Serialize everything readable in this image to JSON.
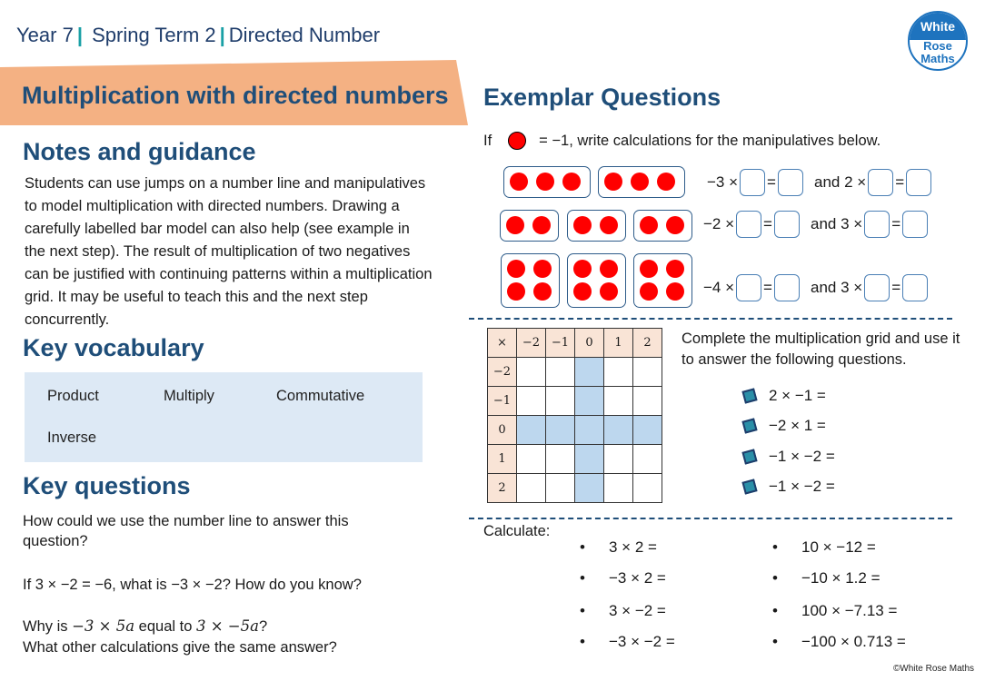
{
  "header": {
    "year": "Year 7",
    "term": "Spring Term  2",
    "unit": "Directed Number",
    "separator": "|",
    "logo": {
      "line1": "White",
      "line2": "Rose",
      "line3": "Maths"
    }
  },
  "left": {
    "title": "Multiplication with directed numbers",
    "notes_heading": "Notes and guidance",
    "notes_text": "Students can use jumps on a number line and manipulatives to model multiplication with directed numbers.  Drawing a carefully labelled bar model can also help (see example in the next step). The result of multiplication of two negatives can be justified with continuing patterns within a multiplication grid.  It may be useful to teach this and the next step concurrently.",
    "vocab_heading": "Key vocabulary",
    "vocab": [
      "Product",
      "Multiply",
      "Commutative",
      "Inverse"
    ],
    "questions_heading": "Key questions",
    "questions": {
      "q1": "How could we use the number line to answer this question?",
      "q2": "If 3 × −2 =  −6, what is −3 × −2?  How do you know?",
      "q3a_pre": "Why is ",
      "q3a_m1": "−3 × 5a",
      "q3a_mid": " equal to ",
      "q3a_m2": "3 × −5a",
      "q3a_post": "?",
      "q3b": "What other calculations give the same answer?"
    }
  },
  "right": {
    "heading": "Exemplar Questions",
    "intro_if": "If",
    "intro_rest": "=  −1, write calculations for the manipulatives below.",
    "rows": [
      {
        "groups": 2,
        "per_group": 3,
        "eq1_prefix": "−3 ×",
        "eq2_prefix": "and 2 ×"
      },
      {
        "groups": 3,
        "per_group": 2,
        "eq1_prefix": "−2 ×",
        "eq2_prefix": "and 3 ×"
      },
      {
        "groups": 3,
        "per_group": 4,
        "eq1_prefix": "−4 ×",
        "eq2_prefix": "and 3 ×"
      }
    ],
    "equals": "=",
    "grid": {
      "corner": "×",
      "col_headers": [
        "−2",
        "−1",
        "0",
        "1",
        "2"
      ],
      "row_headers": [
        "−2",
        "−1",
        "0",
        "1",
        "2"
      ]
    },
    "grid_instruction": "Complete the multiplication grid and use it to answer the following questions.",
    "grid_questions": [
      "2 × −1 =",
      "−2 × 1 =",
      "−1 × −2 =",
      "−1 × −2 ="
    ],
    "calculate_label": "Calculate:",
    "calc_left": [
      "3 × 2 =",
      "−3 × 2 =",
      "3 × −2 =",
      "−3 × −2 ="
    ],
    "calc_right": [
      "10 × −12 =",
      "−10 × 1.2 =",
      "100 ×  −7.13 =",
      "−100 × 0.713 ="
    ],
    "bullet": "•"
  },
  "footer": {
    "copyright": "©White Rose Maths"
  },
  "colors": {
    "navy": "#1f4e79",
    "banner": "#f4b183",
    "vocab_bg": "#dde9f5",
    "counter": "#ff0000",
    "grid_header": "#f9e4d6",
    "grid_zero": "#bdd7ee"
  }
}
